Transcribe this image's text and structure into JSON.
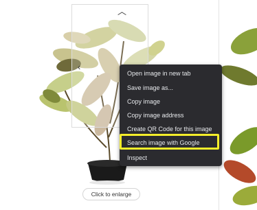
{
  "context_menu": {
    "items": [
      {
        "label": "Open image in new tab"
      },
      {
        "label": "Save image as..."
      },
      {
        "label": "Copy image"
      },
      {
        "label": "Copy image address"
      },
      {
        "label": "Create QR Code for this image"
      },
      {
        "label": "Search image with Google",
        "highlighted": true
      },
      {
        "label": "Inspect"
      }
    ],
    "background": "#2b2b2f",
    "text_color": "#e8eaed"
  },
  "highlight_color": "#f4ee2a",
  "viewer": {
    "enlarge_label": "Click to enlarge",
    "up_arrow_icon": "chevron-up-icon",
    "left_arrow_icon": "chevron-left-icon"
  }
}
